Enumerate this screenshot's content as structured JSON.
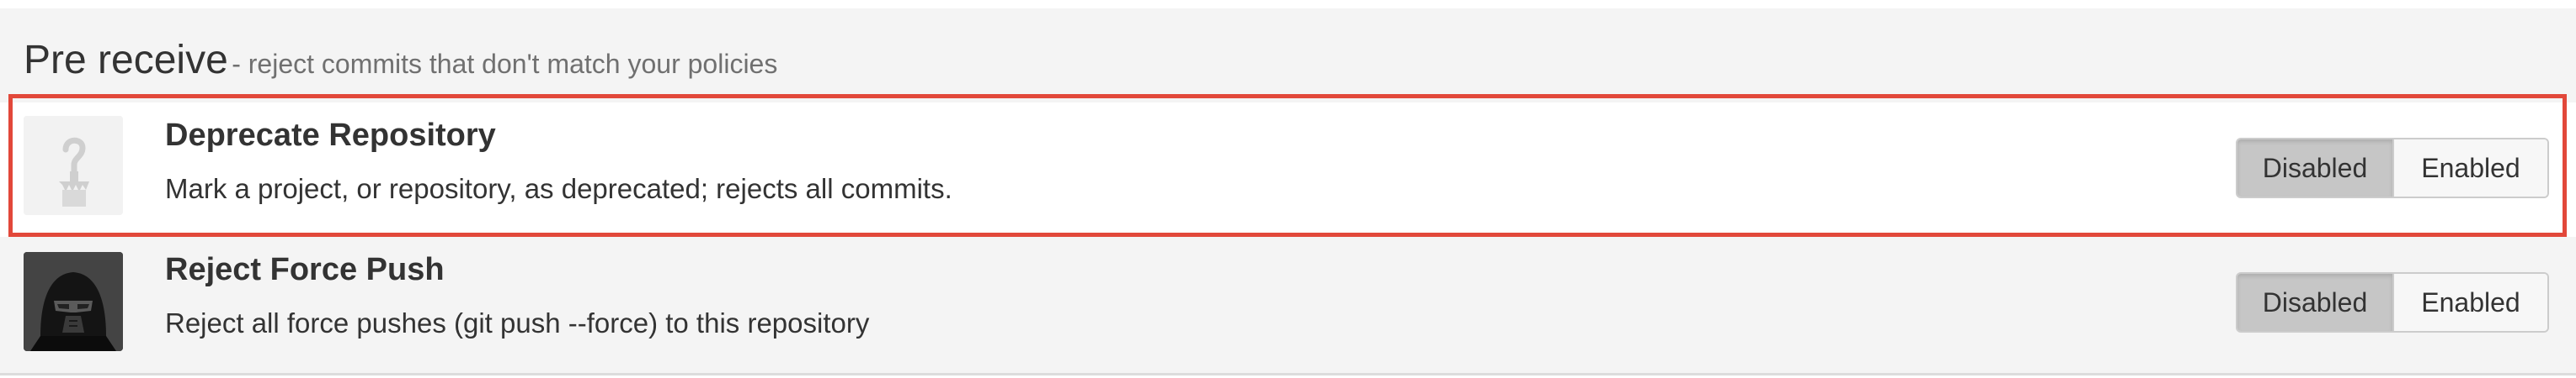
{
  "section": {
    "title": "Pre receive",
    "subtitle": "- reject commits that don't match your policies"
  },
  "colors": {
    "highlight_border": "#e2483a",
    "selected_toggle": "#c6c6c6",
    "panel_background": "#f4f4f4"
  },
  "plugins": [
    {
      "name": "Deprecate Repository",
      "description": "Mark a project, or repository, as deprecated; rejects all commits.",
      "icon": "hook-icon",
      "highlighted": true,
      "toggle": {
        "disabled_label": "Disabled",
        "enabled_label": "Enabled",
        "selected": "Disabled"
      }
    },
    {
      "name": "Reject Force Push",
      "description": "Reject all force pushes (git push --force) to this repository",
      "icon": "darth-vader-icon",
      "highlighted": false,
      "toggle": {
        "disabled_label": "Disabled",
        "enabled_label": "Enabled",
        "selected": "Disabled"
      }
    }
  ]
}
